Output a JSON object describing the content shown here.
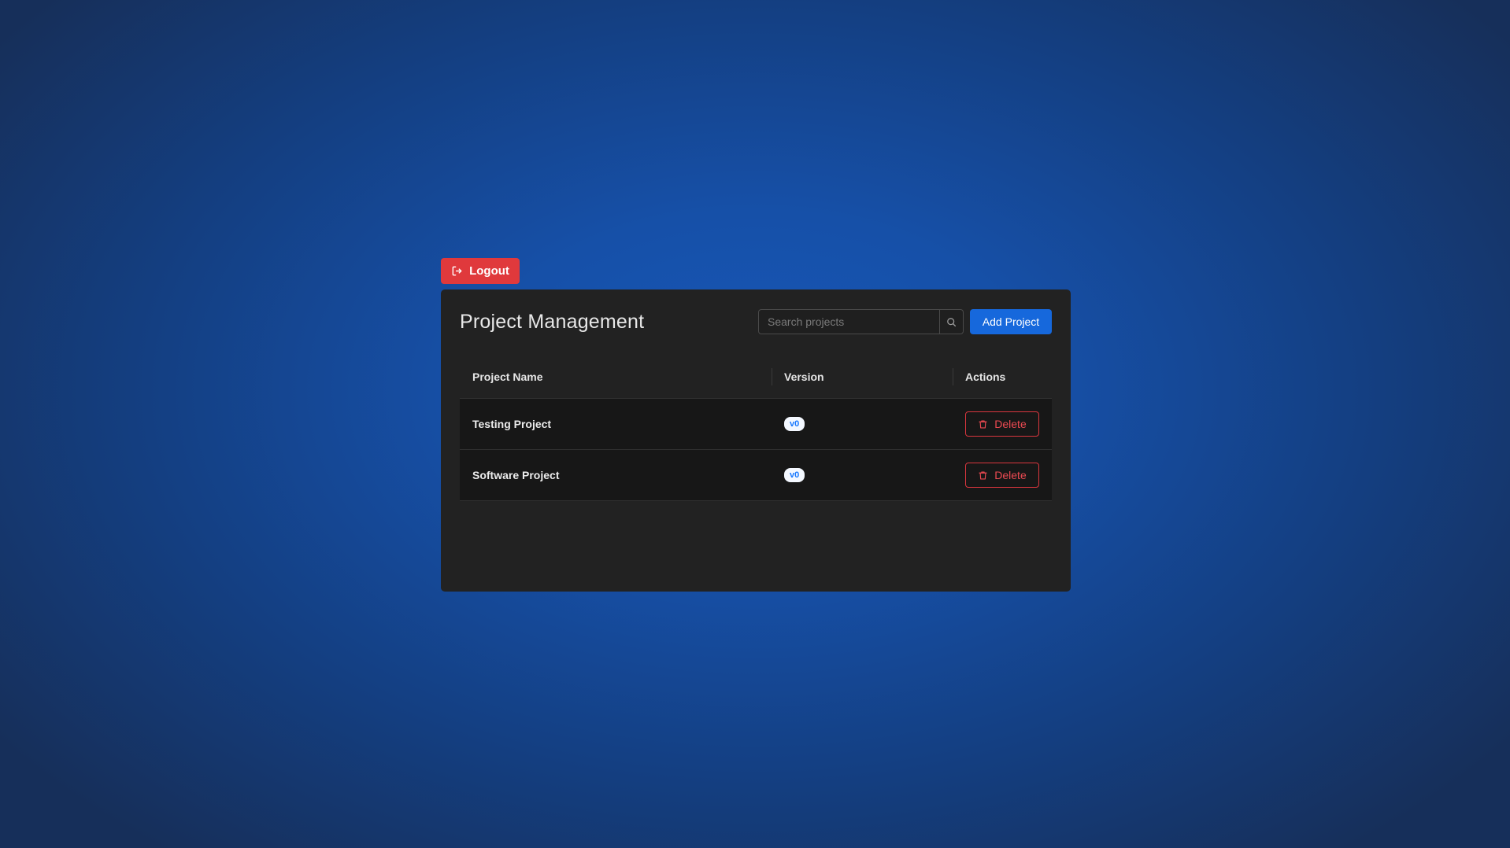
{
  "logout": {
    "label": "Logout",
    "icon": "logout-icon",
    "color": "#e0393c"
  },
  "panel": {
    "title": "Project Management",
    "search": {
      "placeholder": "Search projects",
      "value": "",
      "icon": "search-icon"
    },
    "add_button": {
      "label": "Add Project",
      "color": "#1668dc"
    }
  },
  "table": {
    "columns": [
      "Project Name",
      "Version",
      "Actions"
    ],
    "rows": [
      {
        "name": "Testing Project",
        "version": "v0",
        "action": "Delete"
      },
      {
        "name": "Software Project",
        "version": "v0",
        "action": "Delete"
      }
    ]
  },
  "colors": {
    "panel_bg": "#222222",
    "row_bg": "#171717",
    "danger": "#d9363e",
    "badge_text": "#1677ff"
  }
}
